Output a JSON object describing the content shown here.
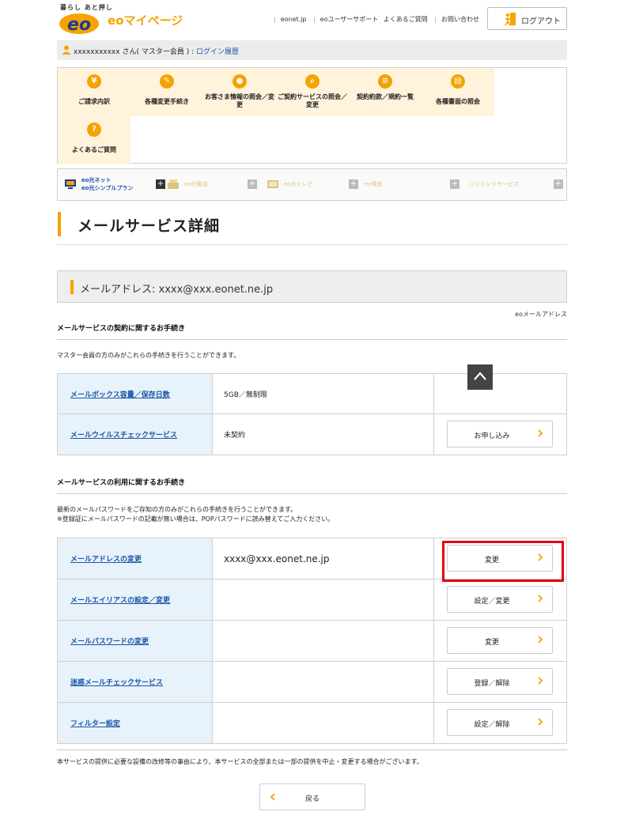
{
  "header": {
    "logo_tagline": "暮らし あと押し",
    "logo_text": "eo",
    "brand": "eoマイページ",
    "links": [
      "eonet.jp",
      "eoユーザーサポート",
      "よくあるご質問",
      "お問い合わせ"
    ],
    "logout_label": "ログアウト"
  },
  "user": {
    "name": "xxxxxxxxxxx",
    "suffix": " さん( マスター会員 ) : ",
    "history_link": "ログイン履歴"
  },
  "menu": {
    "items": [
      {
        "icon": "yen-icon",
        "glyph": "¥",
        "label": "ご請求内訳"
      },
      {
        "icon": "edit-icon",
        "glyph": "✎",
        "label": "各種変更手続き"
      },
      {
        "icon": "person-icon",
        "glyph": "●",
        "label": "お客さま情報の照会／変更"
      },
      {
        "icon": "search-doc-icon",
        "glyph": "⌕",
        "label": "ご契約サービスの照会／変更"
      },
      {
        "icon": "contract-icon",
        "glyph": "≡",
        "label": "契約約款／規約一覧"
      },
      {
        "icon": "document-icon",
        "glyph": "▤",
        "label": "各種書面の照会"
      },
      {
        "icon": "question-icon",
        "glyph": "?",
        "label": "よくあるご質問"
      }
    ]
  },
  "services": {
    "tabs": [
      {
        "line1": "eo光ネット",
        "line2": "eo光シンプルプラン"
      },
      {
        "line1": "eo光電話",
        "line2": ""
      },
      {
        "line1": "eo光テレビ",
        "line2": ""
      },
      {
        "line1": "eo電気",
        "line2": ""
      },
      {
        "line1": "コンテンツサービス",
        "line2": ""
      }
    ]
  },
  "page": {
    "title": "メールサービス詳細",
    "address_label": "メールアドレス: ",
    "address_value": "xxxx@xxx.eonet.ne.jp",
    "right_note": "eoメールアドレス"
  },
  "contract_section": {
    "title": "メールサービスの契約に関するお手続き",
    "note": "マスター会員の方のみがこれらの手続きを行うことができます。",
    "rows": [
      {
        "name": "メールボックス容量／保存日数",
        "value": "5GB／無制限",
        "action": ""
      },
      {
        "name": "メールウイルスチェックサービス",
        "value": "未契約",
        "action": "お申し込み"
      }
    ]
  },
  "usage_section": {
    "title": "メールサービスの利用に関するお手続き",
    "note_line1": "最新のメールパスワードをご存知の方のみがこれらの手続きを行うことができます。",
    "note_line2": "※登録証にメールパスワードの記載が無い場合は、POPパスワードに読み替えてご入力ください。",
    "rows": [
      {
        "name": "メールアドレスの変更",
        "value": "xxxx@xxx.eonet.ne.jp",
        "action": "変更"
      },
      {
        "name": "メールエイリアスの設定／変更",
        "value": "",
        "action": "設定／変更"
      },
      {
        "name": "メールパスワードの変更",
        "value": "",
        "action": "変更"
      },
      {
        "name": "迷惑メールチェックサービス",
        "value": "",
        "action": "登録／解除"
      },
      {
        "name": "フィルター設定",
        "value": "",
        "action": "設定／解除"
      }
    ]
  },
  "footer": {
    "note": "本サービスの提供に必要な設備の改修等の事由により、本サービスの全部または一部の提供を中止・変更する場合がございます。",
    "back_label": "戻る"
  },
  "colors": {
    "accent": "#f5a300",
    "link": "#1a56a8",
    "highlight": "#e60012",
    "cell_bg": "#e8f2fb",
    "menu_bg": "#fff3dc"
  }
}
